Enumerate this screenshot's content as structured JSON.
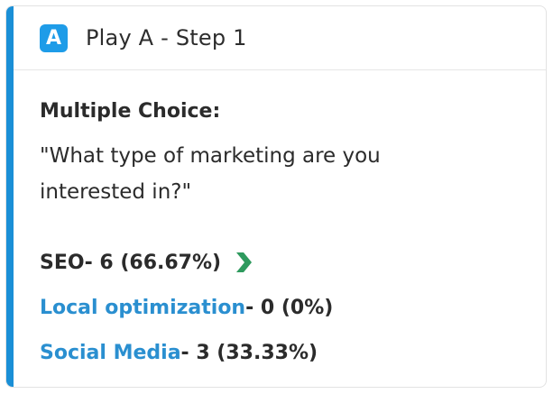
{
  "header": {
    "badge_letter": "A",
    "title": "Play A - Step 1"
  },
  "question": {
    "type_label": "Multiple Choice:",
    "text": "\"What type of marketing are you interested in?\""
  },
  "answers": [
    {
      "label": "SEO",
      "stat": " - 6 (66.67%)",
      "is_link": false,
      "has_chevron": true
    },
    {
      "label": "Local optimization",
      "stat": " - 0 (0%)",
      "is_link": true,
      "has_chevron": false
    },
    {
      "label": "Social Media",
      "stat": " - 3 (33.33%)",
      "is_link": true,
      "has_chevron": false
    }
  ],
  "colors": {
    "accent_bar": "#1a8fd6",
    "badge": "#1e9ce8",
    "link": "#2a8fd0",
    "chevron": "#2e9a5e"
  },
  "icons": {
    "chevron": "chevron-right-icon"
  }
}
